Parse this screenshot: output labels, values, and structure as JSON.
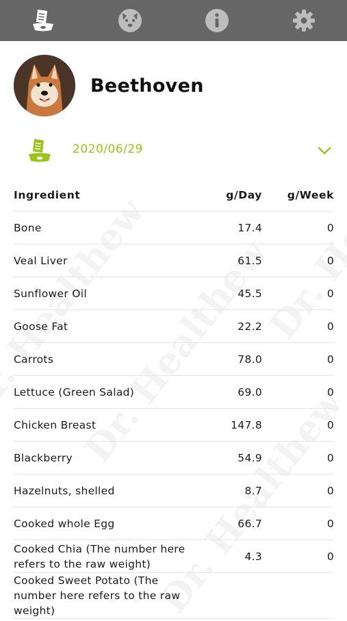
{
  "nav": {
    "tabs": [
      {
        "name": "diet-plan",
        "active": true
      },
      {
        "name": "pet",
        "active": false
      },
      {
        "name": "info",
        "active": false
      },
      {
        "name": "settings",
        "active": false
      }
    ],
    "bar_color": "#666666",
    "icon_color": "#ffffff"
  },
  "profile": {
    "name": "Beethoven"
  },
  "plan": {
    "date": "2020/06/29",
    "accent_color": "#9cc31a"
  },
  "watermark": "Dr. Healthew",
  "table": {
    "headers": [
      "Ingredient",
      "g/Day",
      "g/Week"
    ],
    "rows": [
      {
        "ingredient": "Bone",
        "g_day": "17.4",
        "g_week": "0"
      },
      {
        "ingredient": "Veal Liver",
        "g_day": "61.5",
        "g_week": "0"
      },
      {
        "ingredient": "Sunflower Oil",
        "g_day": "45.5",
        "g_week": "0"
      },
      {
        "ingredient": "Goose Fat",
        "g_day": "22.2",
        "g_week": "0"
      },
      {
        "ingredient": "Carrots",
        "g_day": "78.0",
        "g_week": "0"
      },
      {
        "ingredient": "Lettuce (Green Salad)",
        "g_day": "69.0",
        "g_week": "0"
      },
      {
        "ingredient": "Chicken Breast",
        "g_day": "147.8",
        "g_week": "0"
      },
      {
        "ingredient": "Blackberry",
        "g_day": "54.9",
        "g_week": "0"
      },
      {
        "ingredient": "Hazelnuts, shelled",
        "g_day": "8.7",
        "g_week": "0"
      },
      {
        "ingredient": "Cooked whole Egg",
        "g_day": "66.7",
        "g_week": "0"
      },
      {
        "ingredient": "Cooked Chia (The number here refers to the raw weight)",
        "g_day": "4.3",
        "g_week": "0"
      },
      {
        "ingredient": "Cooked Sweet Potato (The number here refers to the raw weight)",
        "g_day": "",
        "g_week": ""
      }
    ]
  }
}
